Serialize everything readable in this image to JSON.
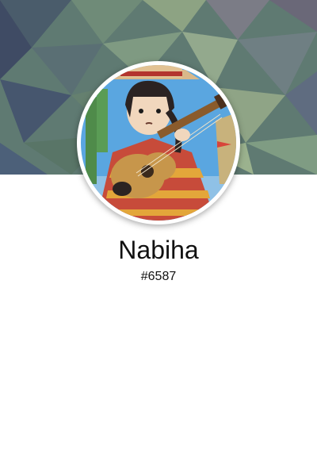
{
  "profile": {
    "username": "Nabiha",
    "discriminator": "#6587"
  },
  "icons": {
    "avatar": "mariachi-guitar-player-avatar",
    "banner": "low-poly-background"
  },
  "colors": {
    "background": "#ffffff",
    "text": "#111111"
  }
}
